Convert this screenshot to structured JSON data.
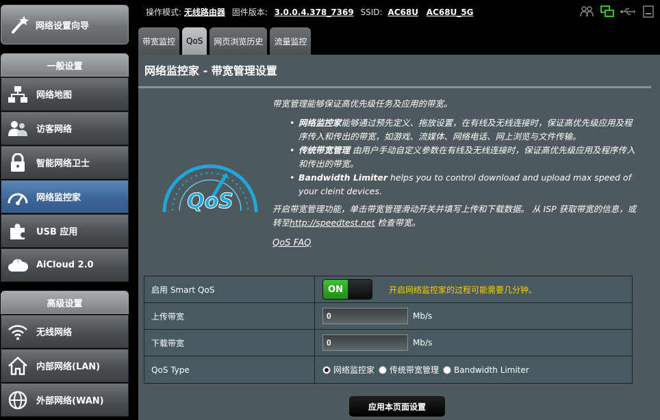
{
  "sidebar": {
    "wizard_label": "网络设置向导",
    "general_head": "一般设置",
    "advanced_head": "高级设置",
    "items": [
      {
        "label": "网络地图",
        "icon": "network-map-icon"
      },
      {
        "label": "访客网络",
        "icon": "guest-network-icon"
      },
      {
        "label": "智能网络卫士",
        "icon": "lock-icon"
      },
      {
        "label": "网络监控家",
        "icon": "speedometer-icon",
        "active": true
      },
      {
        "label": "USB 应用",
        "icon": "puzzle-icon"
      },
      {
        "label": "AiCloud 2.0",
        "icon": "cloud-icon"
      },
      {
        "label": "无线网络",
        "icon": "wifi-icon"
      },
      {
        "label": "内部网络(LAN)",
        "icon": "home-icon"
      },
      {
        "label": "外部网络(WAN)",
        "icon": "globe-icon"
      }
    ]
  },
  "topbar": {
    "mode_label": "操作模式:",
    "mode_value": "无线路由器",
    "fw_label": "固件版本:",
    "fw_value": "3.0.0.4.378_7369",
    "ssid_label": "SSID:",
    "ssid_1": "AC68U",
    "ssid_2": "AC68U_5G",
    "icons": [
      "clients-icon",
      "network-status-icon",
      "usb-icon",
      "printer-icon"
    ]
  },
  "tabs": [
    "带宽监控",
    "QoS",
    "网页浏览历史",
    "流量监控"
  ],
  "active_tab": "QoS",
  "panel": {
    "title": "网络监控家 - 带宽管理设置",
    "intro": "带宽管理能够保证高优先级任务及应用的带宽。",
    "bullets": [
      {
        "bold": "网络监控家",
        "text": "能够通过预先定义、拖放设置，在有线及无线连接时，保证高优先级应用及程序传入和传出的带宽，如游戏、流媒体、网络电话、网上浏览与文件传输。"
      },
      {
        "bold": "传统带宽管理",
        "text": " 由用户手动自定义参数在有线及无线连接时，保证高优先级应用及程序传入和传出的带宽。"
      },
      {
        "bold": "Bandwidth Limiter",
        "text": " helps you to control download and upload max speed of your cleint devices."
      }
    ],
    "enable_text_1": "开启带宽管理功能，单击带宽管理滑动开关并填写上传和下载数据。 从 ISP 获取带宽的信息，或转至",
    "speedtest_link": "http://speedtest.net",
    "enable_text_2": " 检查带宽。",
    "faq_link": "QoS FAQ",
    "logo_text": "QoS"
  },
  "form": {
    "smart_qos_label": "启用 Smart QoS",
    "toggle_on": "ON",
    "smart_qos_note": "开启网络监控家的过程可能需要几分钟。",
    "upload_label": "上传带宽",
    "upload_value": "0",
    "download_label": "下载带宽",
    "download_value": "0",
    "unit": "Mb/s",
    "qos_type_label": "QoS Type",
    "qos_options": [
      "网络监控家",
      "传统带宽管理",
      "Bandwidth Limiter"
    ],
    "qos_selected": "网络监控家"
  },
  "apply_button": "应用本页面设置",
  "colors": {
    "accent_blue": "#3d6496",
    "on_green": "#2fa81f",
    "note_yellow": "#ffcc00",
    "panel_bg": "#4d595d"
  }
}
